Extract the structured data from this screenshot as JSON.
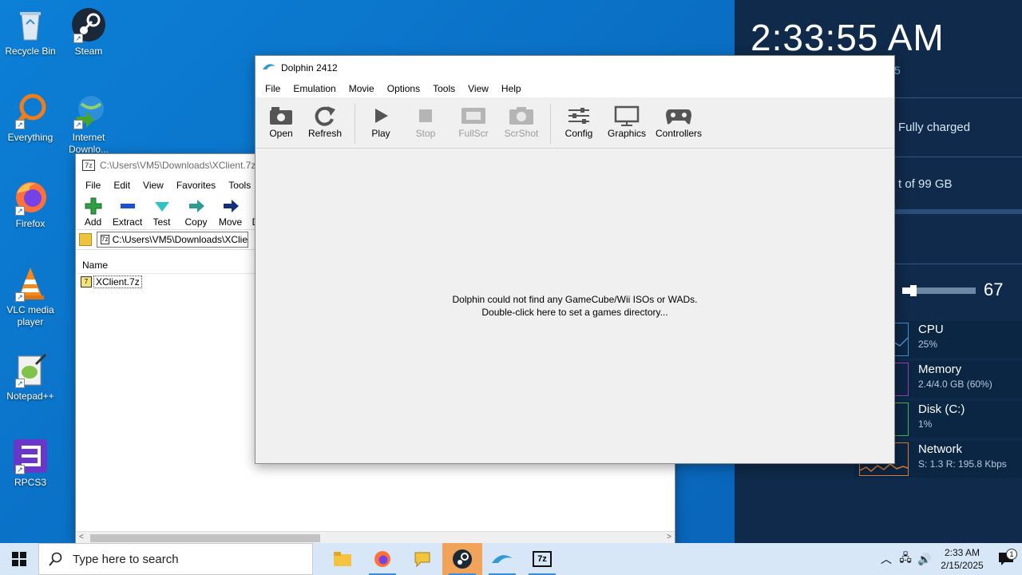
{
  "desktop": {
    "icons": [
      {
        "label": "Recycle Bin"
      },
      {
        "label": "Steam"
      },
      {
        "label": "Everything"
      },
      {
        "label": "Internet Downlo..."
      },
      {
        "label": "Firefox"
      },
      {
        "label": "VLC media player"
      },
      {
        "label": "Notepad++"
      },
      {
        "label": "RPCS3"
      }
    ]
  },
  "widgets": {
    "clock": "2:33:55 AM",
    "date_fragment": "5",
    "battery": "Fully charged",
    "storage": "t of 99 GB",
    "volume": "67",
    "volume_level": 0.08,
    "perf": [
      {
        "name": "CPU",
        "value": "25%",
        "color": "#4a90c8"
      },
      {
        "name": "Memory",
        "value": "2.4/4.0 GB (60%)",
        "color": "#9a3fb0"
      },
      {
        "name": "Disk (C:)",
        "value": "1%",
        "color": "#4caf50"
      },
      {
        "name": "Network",
        "value": "S: 1.3 R: 195.8 Kbps",
        "color": "#e07a30"
      }
    ]
  },
  "zip": {
    "title": "C:\\Users\\VM5\\Downloads\\XClient.7z\\",
    "menu": [
      "File",
      "Edit",
      "View",
      "Favorites",
      "Tools",
      "He"
    ],
    "toolbar": [
      "Add",
      "Extract",
      "Test",
      "Copy",
      "Move",
      "D"
    ],
    "address": "C:\\Users\\VM5\\Downloads\\XClie",
    "col_name": "Name",
    "file": "XClient.7z"
  },
  "dolphin": {
    "title": "Dolphin 2412",
    "menu": [
      "File",
      "Emulation",
      "Movie",
      "Options",
      "Tools",
      "View",
      "Help"
    ],
    "toolbar": {
      "open": "Open",
      "refresh": "Refresh",
      "play": "Play",
      "stop": "Stop",
      "fullscr": "FullScr",
      "scrshot": "ScrShot",
      "config": "Config",
      "graphics": "Graphics",
      "controllers": "Controllers"
    },
    "msg_line1": "Dolphin could not find any GameCube/Wii ISOs or WADs.",
    "msg_line2": "Double-click here to set a games directory..."
  },
  "taskbar": {
    "search_placeholder": "Type here to search",
    "time": "2:33 AM",
    "date": "2/15/2025",
    "notifications": "1",
    "apps": [
      "file-explorer-icon",
      "firefox-icon",
      "chat-icon",
      "steam-icon",
      "dolphin-icon",
      "7zip-icon"
    ]
  }
}
